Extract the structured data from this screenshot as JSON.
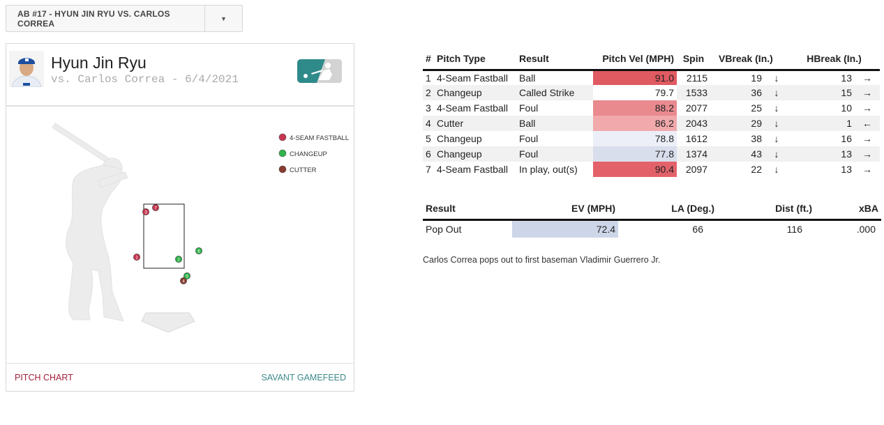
{
  "at_bat_selector": {
    "label": "AB #17 - HYUN JIN RYU VS. CARLOS CORREA",
    "caret": "▼"
  },
  "card": {
    "pitcher_name": "Hyun Jin Ryu",
    "matchup": "vs. Carlos Correa - 6/4/2021",
    "legend": [
      {
        "label": "4-SEAM FASTBALL",
        "color": "#c8344f"
      },
      {
        "label": "CHANGEUP",
        "color": "#2fb34a"
      },
      {
        "label": "CUTTER",
        "color": "#8a3a2e"
      }
    ],
    "pitches": [
      {
        "n": "1",
        "type": "4-SEAM FASTBALL"
      },
      {
        "n": "2",
        "type": "CHANGEUP"
      },
      {
        "n": "3",
        "type": "4-SEAM FASTBALL"
      },
      {
        "n": "4",
        "type": "CUTTER"
      },
      {
        "n": "5",
        "type": "CHANGEUP"
      },
      {
        "n": "6",
        "type": "CHANGEUP"
      },
      {
        "n": "7",
        "type": "4-SEAM FASTBALL"
      }
    ],
    "footer_left": "PITCH CHART",
    "footer_right": "SAVANT GAMEFEED"
  },
  "pitch_table": {
    "headers": [
      "#",
      "Pitch Type",
      "Result",
      "Pitch Vel (MPH)",
      "Spin",
      "VBreak (In.)",
      "HBreak (In.)"
    ],
    "rows": [
      {
        "n": "1",
        "type": "4-Seam Fastball",
        "result": "Ball",
        "vel": "91.0",
        "vel_color": "#e05a62",
        "spin": "2115",
        "vbreak": "19",
        "varrow": "↓",
        "hbreak": "13",
        "harrow": "→"
      },
      {
        "n": "2",
        "type": "Changeup",
        "result": "Called Strike",
        "vel": "79.7",
        "vel_color": "#ffffff",
        "spin": "1533",
        "vbreak": "36",
        "varrow": "↓",
        "hbreak": "15",
        "harrow": "→"
      },
      {
        "n": "3",
        "type": "4-Seam Fastball",
        "result": "Foul",
        "vel": "88.2",
        "vel_color": "#e98a8f",
        "spin": "2077",
        "vbreak": "25",
        "varrow": "↓",
        "hbreak": "10",
        "harrow": "→"
      },
      {
        "n": "4",
        "type": "Cutter",
        "result": "Ball",
        "vel": "86.2",
        "vel_color": "#f1a9ac",
        "spin": "2043",
        "vbreak": "29",
        "varrow": "↓",
        "hbreak": "1",
        "harrow": "←"
      },
      {
        "n": "5",
        "type": "Changeup",
        "result": "Foul",
        "vel": "78.8",
        "vel_color": "#eceff7",
        "spin": "1612",
        "vbreak": "38",
        "varrow": "↓",
        "hbreak": "16",
        "harrow": "→"
      },
      {
        "n": "6",
        "type": "Changeup",
        "result": "Foul",
        "vel": "77.8",
        "vel_color": "#d9deed",
        "spin": "1374",
        "vbreak": "43",
        "varrow": "↓",
        "hbreak": "13",
        "harrow": "→"
      },
      {
        "n": "7",
        "type": "4-Seam Fastball",
        "result": "In play, out(s)",
        "vel": "90.4",
        "vel_color": "#e3626a",
        "spin": "2097",
        "vbreak": "22",
        "varrow": "↓",
        "hbreak": "13",
        "harrow": "→"
      }
    ]
  },
  "result_table": {
    "headers": [
      "Result",
      "EV (MPH)",
      "LA (Deg.)",
      "Dist (ft.)",
      "xBA"
    ],
    "row": {
      "result": "Pop Out",
      "ev": "72.4",
      "ev_color": "#cdd6e8",
      "la": "66",
      "dist": "116",
      "xba": ".000"
    }
  },
  "description": "Carlos Correa pops out to first baseman Vladimir Guerrero Jr."
}
